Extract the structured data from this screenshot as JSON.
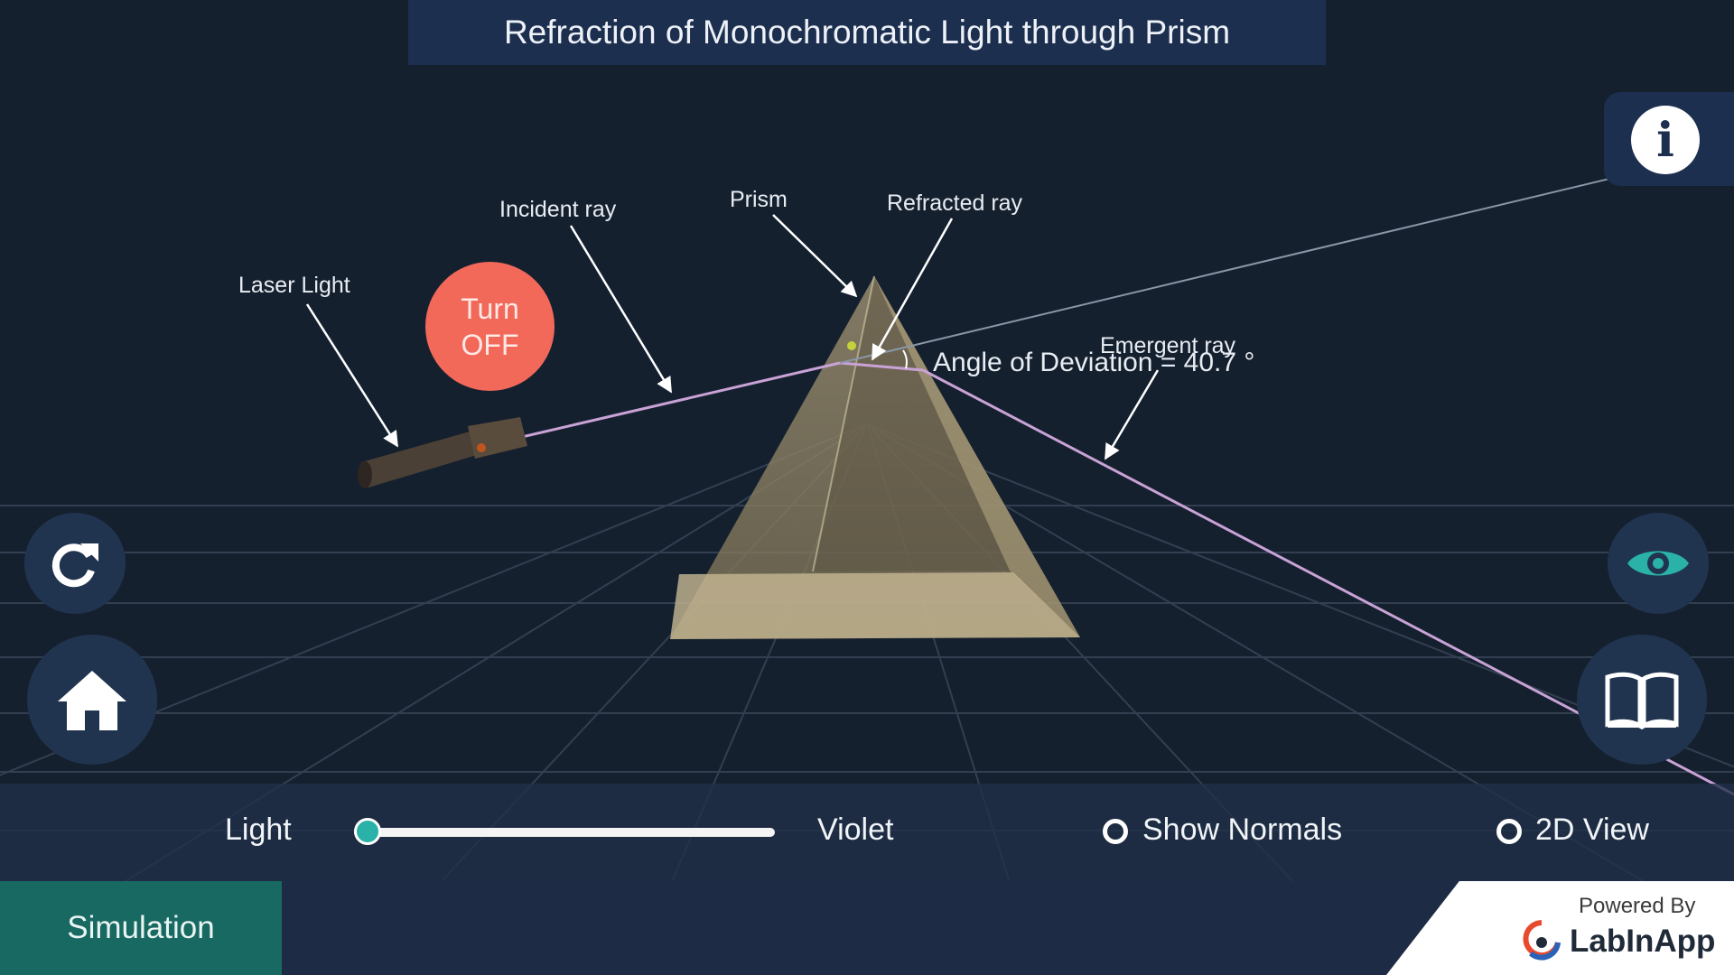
{
  "header": {
    "title": "Refraction of Monochromatic Light through Prism"
  },
  "scene": {
    "labels": {
      "laser_light": "Laser Light",
      "incident_ray": "Incident ray",
      "prism": "Prism",
      "refracted_ray": "Refracted ray",
      "emergent_ray": "Emergent ray"
    },
    "angle_of_deviation": "Angle of Deviation = 40.7 °",
    "turn_off_line1": "Turn",
    "turn_off_line2": "OFF"
  },
  "controls": {
    "light_label": "Light",
    "color_value": "Violet",
    "light_slider_fraction": 0.0,
    "show_normals_label": "Show Normals",
    "show_normals_checked": false,
    "view_2d_label": "2D View",
    "view_2d_checked": false
  },
  "icons": {
    "info": "info-icon",
    "reset": "reset-icon",
    "home": "home-icon",
    "eye": "eye-icon",
    "book": "book-icon"
  },
  "footer": {
    "tab_label": "Simulation",
    "powered_by": "Powered By",
    "brand": "LabInApp"
  },
  "colors": {
    "background": "#15202f",
    "panel": "#1d2f4f",
    "accent_teal": "#2ab2a8",
    "turn_off_red": "#f2695a",
    "ray": "#c9a2d6"
  }
}
